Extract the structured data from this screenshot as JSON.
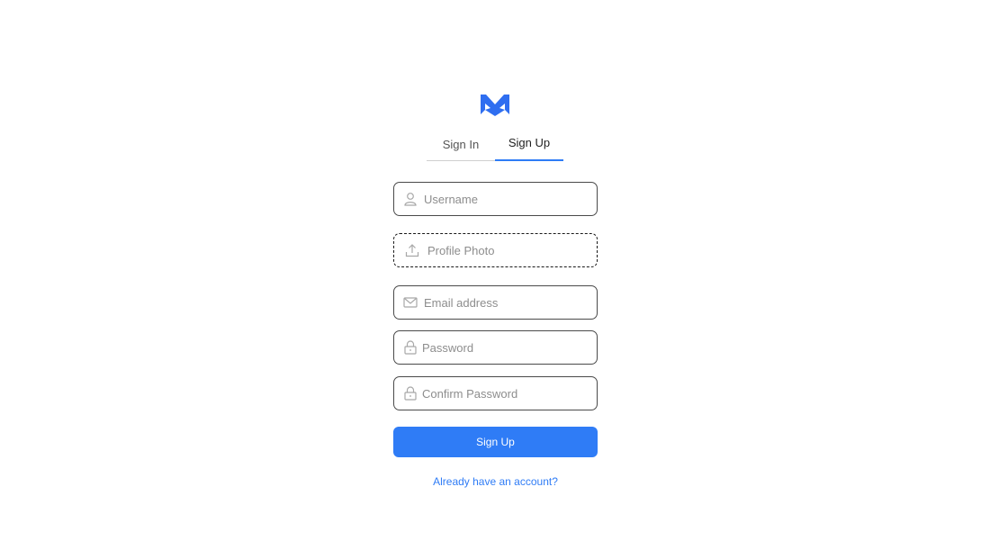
{
  "brand": {
    "logo_icon": "m-logo-icon",
    "accent_color": "#2f7cf6"
  },
  "tabs": [
    {
      "label": "Sign In",
      "active": false
    },
    {
      "label": "Sign Up",
      "active": true
    }
  ],
  "form": {
    "username": {
      "placeholder": "Username",
      "value": "",
      "icon": "user-icon"
    },
    "profile_photo": {
      "label": "Profile Photo",
      "icon": "upload-icon"
    },
    "email": {
      "placeholder": "Email address",
      "value": "",
      "icon": "mail-icon"
    },
    "password": {
      "placeholder": "Password",
      "value": "",
      "icon": "lock-icon"
    },
    "confirm_password": {
      "placeholder": "Confirm Password",
      "value": "",
      "icon": "lock-icon"
    },
    "submit_label": "Sign Up"
  },
  "footer": {
    "login_link": "Already have an account?"
  }
}
